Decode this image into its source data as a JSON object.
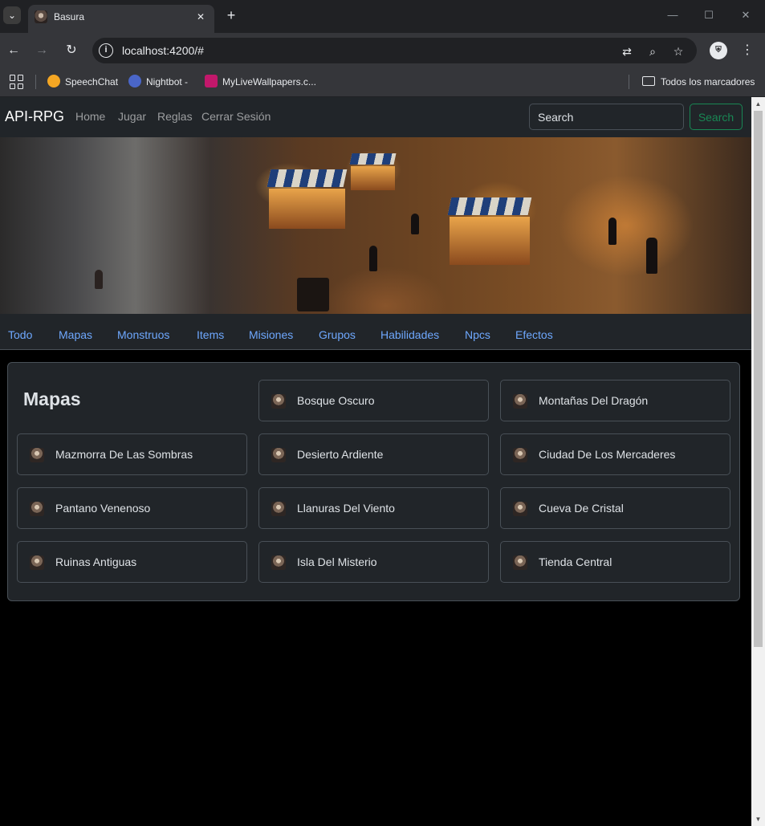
{
  "browser": {
    "tab_title": "Basura",
    "tab_close": "✕",
    "new_tab": "+",
    "url": "localhost:4200/#",
    "window_controls": {
      "minimize": "—",
      "maximize": "☐",
      "close": "✕"
    },
    "bookmarks": [
      {
        "label": "SpeechChat",
        "icon": "speechchat-icon",
        "color": "#f4a623"
      },
      {
        "label": "Nightbot -",
        "icon": "nightbot-icon",
        "color": "#4a66c8"
      },
      {
        "label": "MyLiveWallpapers.c...",
        "icon": "mylivewallpapers-icon",
        "color": "#c2186b"
      }
    ],
    "all_bookmarks": "Todos los marcadores"
  },
  "app": {
    "brand": "API-RPG",
    "nav": [
      "Home",
      "Jugar",
      "Reglas",
      "Cerrar Sesión"
    ],
    "search": {
      "placeholder": "Search",
      "button": "Search"
    },
    "categories": [
      "Todo",
      "Mapas",
      "Monstruos",
      "Items",
      "Misiones",
      "Grupos",
      "Habilidades",
      "Npcs",
      "Efectos"
    ],
    "section_title": "Mapas",
    "maps": [
      "Bosque Oscuro",
      "Montañas Del Dragón",
      "Mazmorra De Las Sombras",
      "Desierto Ardiente",
      "Ciudad De Los Mercaderes",
      "Pantano Venenoso",
      "Llanuras Del Viento",
      "Cueva De Cristal",
      "Ruinas Antiguas",
      "Isla Del Misterio",
      "Tienda Central"
    ]
  },
  "colors": {
    "navbar_bg": "#212529",
    "link_blue": "#6ea8fe",
    "search_green": "#198754",
    "border": "#495057"
  }
}
